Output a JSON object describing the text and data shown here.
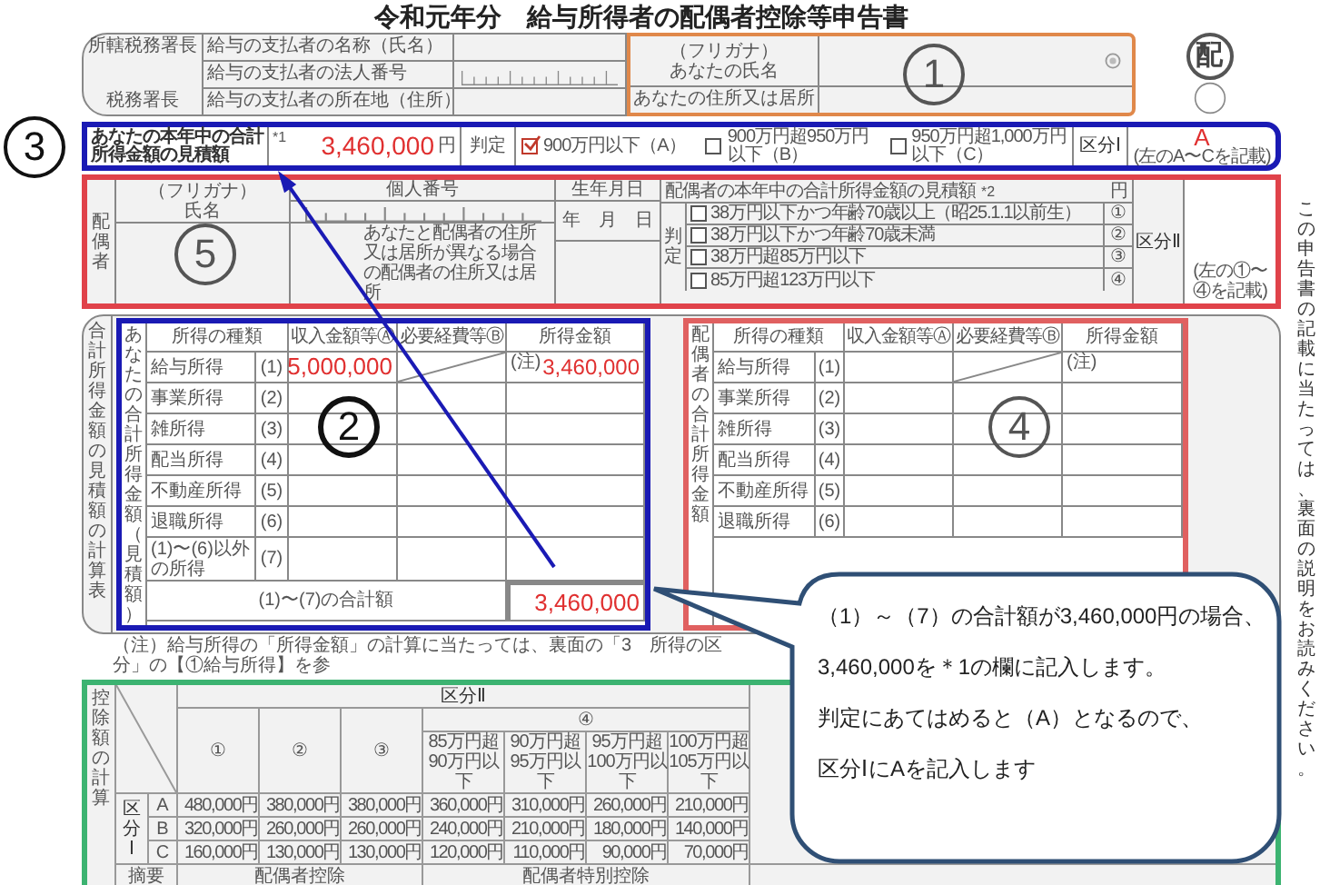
{
  "title": "令和元年分　給与所得者の配偶者控除等申告書",
  "payer": {
    "office_label": "所轄税務署長",
    "office_suffix": "税務署長",
    "fields": [
      "給与の支払者の名称（氏名）",
      "給与の支払者の法人番号",
      "給与の支払者の所在地（住所）"
    ]
  },
  "applicant": {
    "furigana": "（フリガナ）",
    "name_label": "あなたの氏名",
    "address_label": "あなたの住所又は居所",
    "marker": "1"
  },
  "stamp": "配",
  "income_estimate": {
    "marker": "3",
    "label": "あなたの本年中の合計所得金額の見積額",
    "note_mark": "*1",
    "amount": "3,460,000",
    "unit": "円",
    "judge_label": "判定",
    "options": [
      {
        "label": "900万円以下（A）",
        "checked": true
      },
      {
        "label": "900万円超950万円以下（B）",
        "checked": false
      },
      {
        "label": "950万円超1,000万円以下（C）",
        "checked": false
      }
    ],
    "class_label": "区分Ⅰ",
    "class_value": "A",
    "class_hint": "(左のA〜Cを記載)"
  },
  "spouse": {
    "marker": "5",
    "side_label": "配偶者",
    "furigana": "（フリガナ）",
    "name_label": "氏名",
    "number_label": "個人番号",
    "birth_label": "生年月日",
    "birth_units": "年　月　日",
    "address_label": "あなたと配偶者の住所又は居所が異なる場合の配偶者の住所又は居所",
    "income_label": "配偶者の本年中の合計所得金額の見積額",
    "note_mark": "*2",
    "unit": "円",
    "judge_label": "判定",
    "options": [
      {
        "label": "38万円以下かつ年齢70歳以上（昭25.1.1以前生）",
        "number": "①",
        "checked": false
      },
      {
        "label": "38万円以下かつ年齢70歳未満",
        "number": "②",
        "checked": false
      },
      {
        "label": "38万円超85万円以下",
        "number": "③",
        "checked": false
      },
      {
        "label": "85万円超123万円以下",
        "number": "④",
        "checked": false
      }
    ],
    "class_label": "区分Ⅱ",
    "class_hint": "(左の①〜④を記載)"
  },
  "calc": {
    "side_label": "合計所得金額の見積額の計算表",
    "own_table": {
      "marker": "2",
      "side_label": "あなたの合計所得金額（見積額）",
      "columns": [
        "所得の種類",
        "収入金額等Ⓐ",
        "必要経費等Ⓑ",
        "所得金額"
      ],
      "rows": [
        {
          "name": "給与所得",
          "number": "(1)",
          "income": "5,000,000",
          "note": "(注)",
          "amount": "3,460,000"
        },
        {
          "name": "事業所得",
          "number": "(2)"
        },
        {
          "name": "雑所得",
          "number": "(3)"
        },
        {
          "name": "配当所得",
          "number": "(4)"
        },
        {
          "name": "不動産所得",
          "number": "(5)"
        },
        {
          "name": "退職所得",
          "number": "(6)"
        },
        {
          "name": "(1)〜(6)以外の所得",
          "number": "(7)"
        }
      ],
      "total_label": "(1)〜(7)の合計額",
      "total": "3,460,000"
    },
    "spouse_table": {
      "marker": "4",
      "side_label": "配偶者の合計所得金額",
      "columns": [
        "所得の種類",
        "収入金額等Ⓐ",
        "必要経費等Ⓑ",
        "所得金額"
      ],
      "rows": [
        {
          "name": "給与所得",
          "number": "(1)",
          "note": "(注)"
        },
        {
          "name": "事業所得",
          "number": "(2)"
        },
        {
          "name": "雑所得",
          "number": "(3)"
        },
        {
          "name": "配当所得",
          "number": "(4)"
        },
        {
          "name": "不動産所得",
          "number": "(5)"
        },
        {
          "name": "退職所得",
          "number": "(6)"
        }
      ]
    },
    "note": "（注）給与所得の「所得金額」の計算に当たっては、裏面の「3　所得の区分」の【①給与所得】を参"
  },
  "deduction": {
    "side_label": "控除額の計算",
    "header": "区分Ⅱ",
    "columns": [
      "①",
      "②",
      "③"
    ],
    "group_label": "④",
    "sub_columns": [
      "85万円超90万円以下",
      "90万円超95万円以下",
      "95万円超100万円以下",
      "100万円超105万円以下"
    ],
    "row_group_label": "区分Ⅰ",
    "rows": [
      {
        "label": "A",
        "values": [
          "480,000円",
          "380,000円",
          "380,000円",
          "360,000円",
          "310,000円",
          "260,000円",
          "210,000円"
        ]
      },
      {
        "label": "B",
        "values": [
          "320,000円",
          "260,000円",
          "260,000円",
          "240,000円",
          "210,000円",
          "180,000円",
          "140,000円"
        ]
      },
      {
        "label": "C",
        "values": [
          "160,000円",
          "130,000円",
          "130,000円",
          "120,000円",
          "110,000円",
          "90,000円",
          "70,000円"
        ]
      }
    ],
    "footer": [
      "摘要",
      "配偶者控除",
      "配偶者特別控除"
    ]
  },
  "side_note": "この申告書の記載に当たっては、裏面の説明をお読みください。",
  "callout": [
    "（1）～（7）の合計額が3,460,000円の場合、",
    "3,460,000を＊1の欄に記入します。",
    "判定にあてはめると（A）となるので、",
    "区分ⅠにAを記入します"
  ]
}
